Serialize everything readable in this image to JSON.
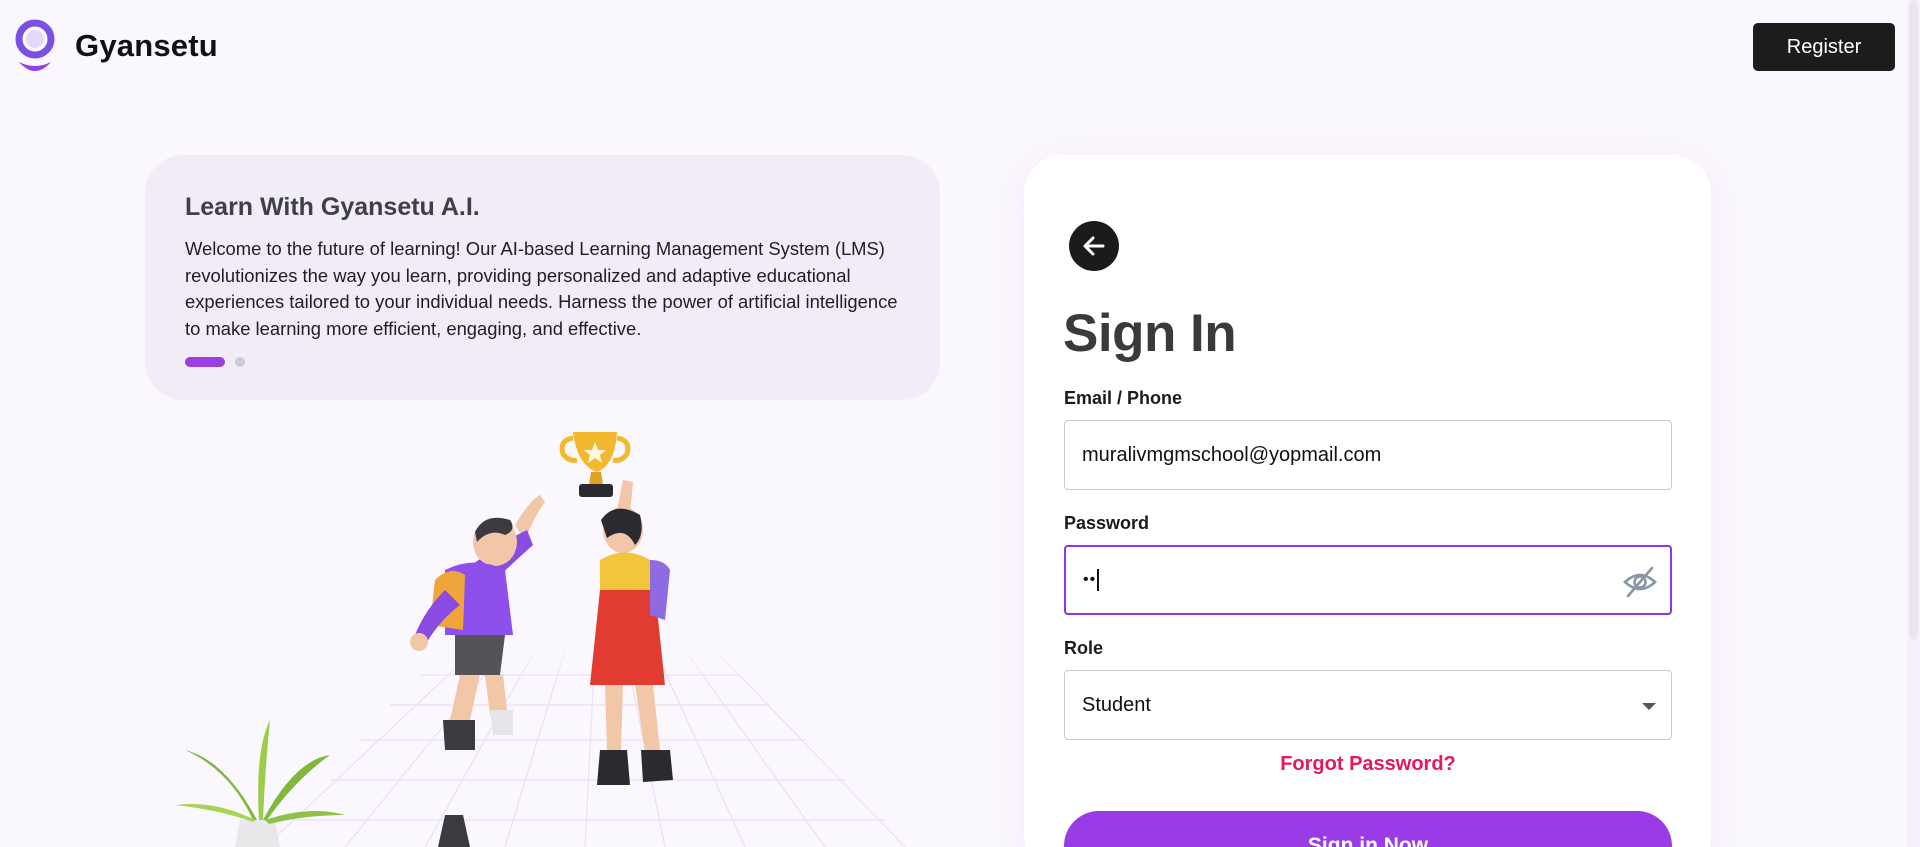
{
  "header": {
    "brand": "Gyansetu",
    "register_label": "Register"
  },
  "info": {
    "title": "Learn With Gyansetu A.I.",
    "body": "Welcome to the future of learning! Our AI-based Learning Management System (LMS) revolutionizes the way you learn, providing personalized and adaptive educational experiences tailored to your individual needs. Harness the power of artificial intelligence to make learning more efficient, engaging, and effective."
  },
  "signin": {
    "title": "Sign In",
    "email_label": "Email / Phone",
    "email_value": "muralivmgmschool@yopmail.com",
    "password_label": "Password",
    "password_masked": "••",
    "role_label": "Role",
    "role_value": "Student",
    "forgot_label": "Forgot Password?",
    "submit_label": "Sign in Now"
  },
  "icons": {
    "back": "arrow-left-icon",
    "eye": "eye-off-icon",
    "dropdown": "caret-down-icon"
  },
  "colors": {
    "accent": "#9a3ce6",
    "link": "#e8175d",
    "dark": "#1c1c1c",
    "background": "#fbf7fe"
  },
  "carousel": {
    "slides": 2,
    "active_index": 0
  }
}
